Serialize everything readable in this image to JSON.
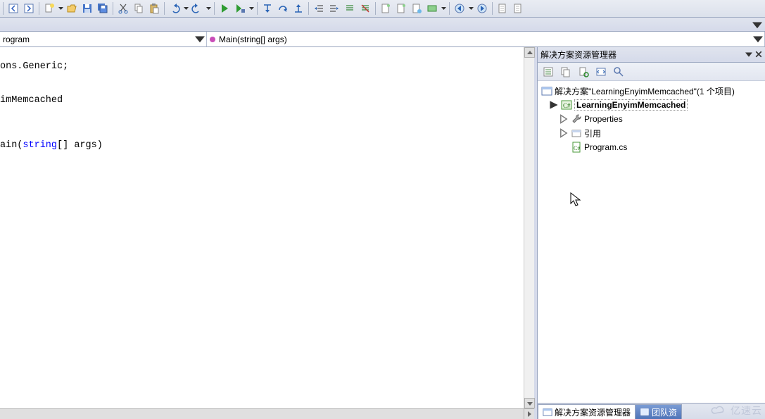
{
  "dropdowns": {
    "class_selector": "rogram",
    "method_selector": "Main(string[] args)"
  },
  "code": {
    "line1": "ons.Generic;",
    "line2": "imMemcached",
    "line3_prefix": "ain(",
    "line3_kw": "string",
    "line3_suffix": "[] args)"
  },
  "solution_explorer": {
    "title": "解决方案资源管理器",
    "solution_label": "解决方案\"LearningEnyimMemcached\"(1 个项目)",
    "project": "LearningEnyimMemcached",
    "nodes": {
      "properties": "Properties",
      "references": "引用",
      "program": "Program.cs"
    }
  },
  "bottom_tabs": {
    "active": "解决方案资源管理器",
    "inactive": "团队资"
  },
  "watermark": "亿速云",
  "icons": {
    "toolbar": [
      "back-icon",
      "forward-icon",
      "new-item-icon",
      "open-icon",
      "save-icon",
      "save-all-icon",
      "cut-icon",
      "copy-icon",
      "paste-icon",
      "undo-icon",
      "redo-icon",
      "run-icon",
      "run-config-icon",
      "step-into-icon",
      "step-over-icon",
      "step-out-icon",
      "indent-left-icon",
      "indent-right-icon",
      "comment-icon",
      "uncomment-icon",
      "doc-new-icon",
      "doc-open-icon",
      "doc-refresh-icon",
      "highlight-green-icon",
      "nav-back-icon",
      "nav-forward-icon",
      "doc1-icon",
      "doc2-icon"
    ],
    "sx_toolbar": [
      "properties-icon",
      "show-all-icon",
      "refresh-icon",
      "view-code-icon",
      "view-designer-icon"
    ]
  }
}
